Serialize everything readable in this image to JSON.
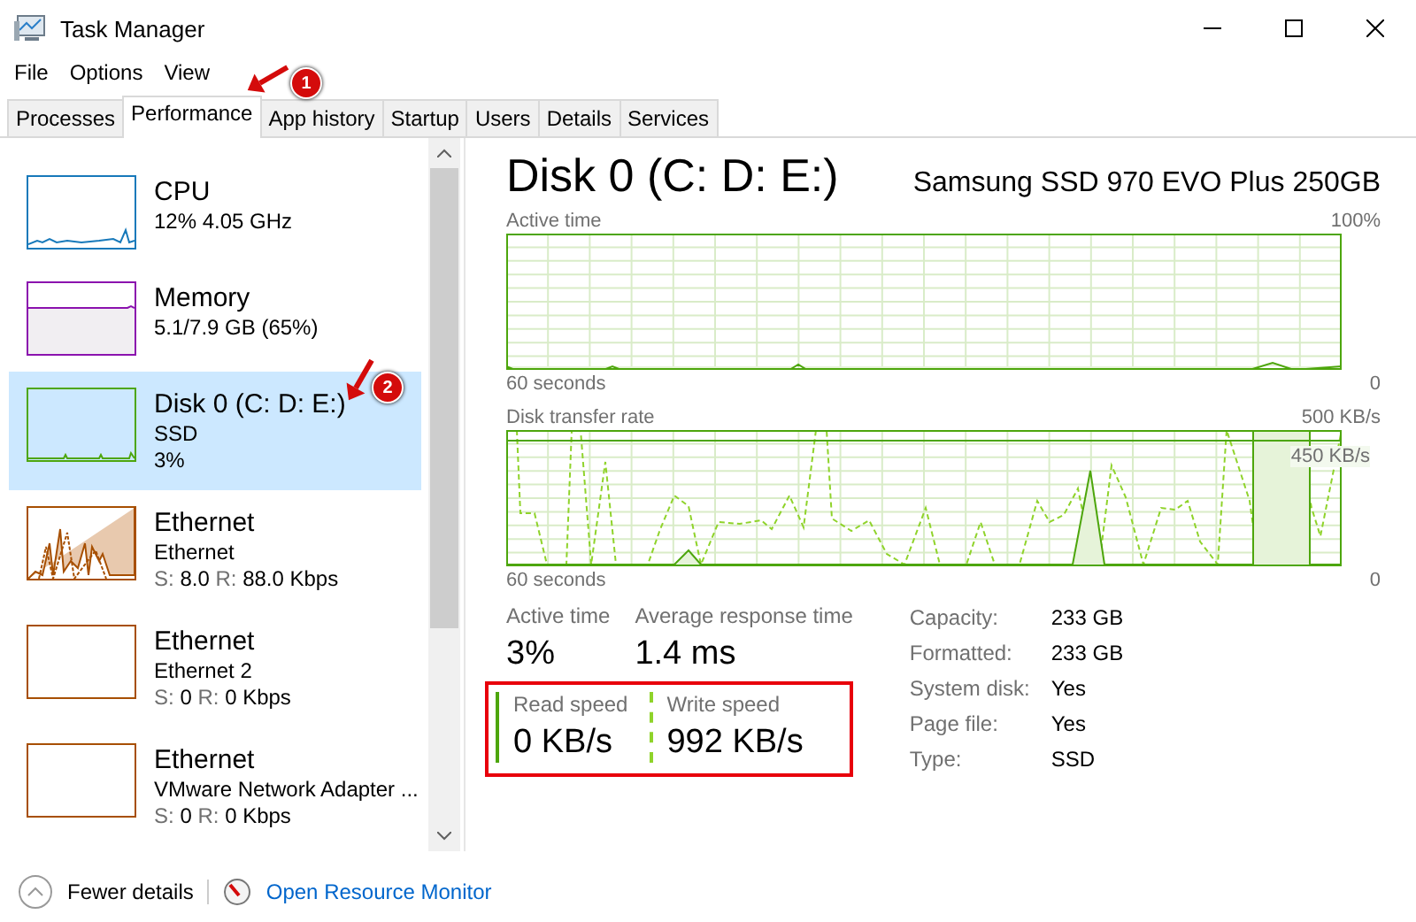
{
  "window": {
    "title": "Task Manager"
  },
  "menu": [
    "File",
    "Options",
    "View"
  ],
  "tabs": [
    {
      "label": "Processes",
      "selected": false
    },
    {
      "label": "Performance",
      "selected": true
    },
    {
      "label": "App history",
      "selected": false
    },
    {
      "label": "Startup",
      "selected": false
    },
    {
      "label": "Users",
      "selected": false
    },
    {
      "label": "Details",
      "selected": false
    },
    {
      "label": "Services",
      "selected": false
    }
  ],
  "sidebar": {
    "items": [
      {
        "kind": "cpu",
        "name": "CPU",
        "line1": "12% 4.05 GHz",
        "color": "#1779ba",
        "selected": false
      },
      {
        "kind": "memory",
        "name": "Memory",
        "line1": "5.1/7.9 GB (65%)",
        "color": "#8b12ae",
        "selected": false
      },
      {
        "kind": "disk",
        "name": "Disk 0 (C: D: E:)",
        "line1": "SSD",
        "line2": "3%",
        "color": "#4da60c",
        "selected": true
      },
      {
        "kind": "network",
        "name": "Ethernet",
        "line1": "Ethernet",
        "s_label": "S:",
        "s_value": "8.0",
        "r_label": "R:",
        "r_value": "88.0 Kbps",
        "color": "#a74f01",
        "selected": false
      },
      {
        "kind": "network",
        "name": "Ethernet",
        "line1": "Ethernet 2",
        "s_label": "S:",
        "s_value": "0",
        "r_label": "R:",
        "r_value": "0 Kbps",
        "color": "#a74f01",
        "selected": false
      },
      {
        "kind": "network",
        "name": "Ethernet",
        "line1": "VMware Network Adapter ...",
        "s_label": "S:",
        "s_value": "0",
        "r_label": "R:",
        "r_value": "0 Kbps",
        "color": "#a74f01",
        "selected": false
      }
    ]
  },
  "detail": {
    "title": "Disk 0 (C: D: E:)",
    "model": "Samsung SSD 970 EVO Plus 250GB",
    "graphs": [
      {
        "label": "Active time",
        "max": "100%",
        "span": "60 seconds",
        "min": "0"
      },
      {
        "label": "Disk transfer rate",
        "max": "500 KB/s",
        "marker": "450 KB/s",
        "span": "60 seconds",
        "min": "0"
      }
    ],
    "stats": [
      {
        "label": "Active time",
        "value": "3%"
      },
      {
        "label": "Average response time",
        "value": "1.4 ms"
      }
    ],
    "speeds": {
      "highlighted": true,
      "items": [
        {
          "label": "Read speed",
          "value": "0 KB/s",
          "kind": "solid"
        },
        {
          "label": "Write speed",
          "value": "992 KB/s",
          "kind": "dashed"
        }
      ]
    },
    "properties": [
      {
        "key": "Capacity:",
        "value": "233 GB"
      },
      {
        "key": "Formatted:",
        "value": "233 GB"
      },
      {
        "key": "System disk:",
        "value": "Yes"
      },
      {
        "key": "Page file:",
        "value": "Yes"
      },
      {
        "key": "Type:",
        "value": "SSD"
      }
    ]
  },
  "footer": {
    "fewer": "Fewer details",
    "link": "Open Resource Monitor"
  },
  "annotations": [
    {
      "label": "1"
    },
    {
      "label": "2"
    }
  ]
}
